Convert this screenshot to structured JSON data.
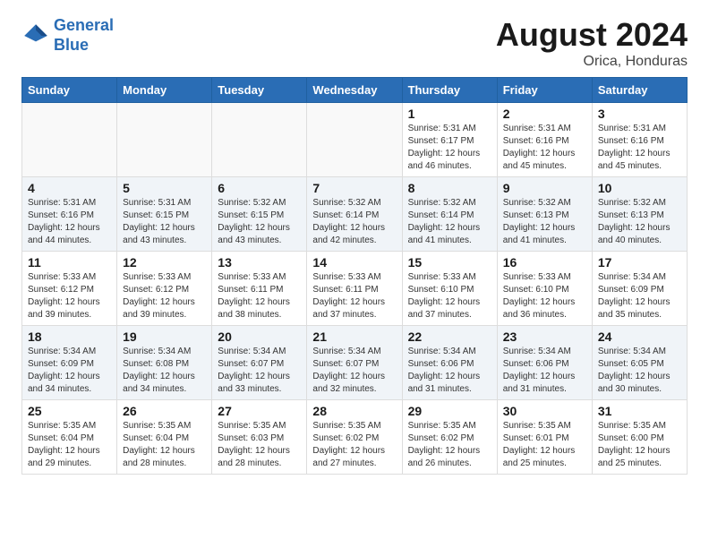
{
  "header": {
    "logo_line1": "General",
    "logo_line2": "Blue",
    "month_year": "August 2024",
    "location": "Orica, Honduras"
  },
  "days_of_week": [
    "Sunday",
    "Monday",
    "Tuesday",
    "Wednesday",
    "Thursday",
    "Friday",
    "Saturday"
  ],
  "weeks": [
    [
      {
        "day": "",
        "detail": ""
      },
      {
        "day": "",
        "detail": ""
      },
      {
        "day": "",
        "detail": ""
      },
      {
        "day": "",
        "detail": ""
      },
      {
        "day": "1",
        "detail": "Sunrise: 5:31 AM\nSunset: 6:17 PM\nDaylight: 12 hours\nand 46 minutes."
      },
      {
        "day": "2",
        "detail": "Sunrise: 5:31 AM\nSunset: 6:16 PM\nDaylight: 12 hours\nand 45 minutes."
      },
      {
        "day": "3",
        "detail": "Sunrise: 5:31 AM\nSunset: 6:16 PM\nDaylight: 12 hours\nand 45 minutes."
      }
    ],
    [
      {
        "day": "4",
        "detail": "Sunrise: 5:31 AM\nSunset: 6:16 PM\nDaylight: 12 hours\nand 44 minutes."
      },
      {
        "day": "5",
        "detail": "Sunrise: 5:31 AM\nSunset: 6:15 PM\nDaylight: 12 hours\nand 43 minutes."
      },
      {
        "day": "6",
        "detail": "Sunrise: 5:32 AM\nSunset: 6:15 PM\nDaylight: 12 hours\nand 43 minutes."
      },
      {
        "day": "7",
        "detail": "Sunrise: 5:32 AM\nSunset: 6:14 PM\nDaylight: 12 hours\nand 42 minutes."
      },
      {
        "day": "8",
        "detail": "Sunrise: 5:32 AM\nSunset: 6:14 PM\nDaylight: 12 hours\nand 41 minutes."
      },
      {
        "day": "9",
        "detail": "Sunrise: 5:32 AM\nSunset: 6:13 PM\nDaylight: 12 hours\nand 41 minutes."
      },
      {
        "day": "10",
        "detail": "Sunrise: 5:32 AM\nSunset: 6:13 PM\nDaylight: 12 hours\nand 40 minutes."
      }
    ],
    [
      {
        "day": "11",
        "detail": "Sunrise: 5:33 AM\nSunset: 6:12 PM\nDaylight: 12 hours\nand 39 minutes."
      },
      {
        "day": "12",
        "detail": "Sunrise: 5:33 AM\nSunset: 6:12 PM\nDaylight: 12 hours\nand 39 minutes."
      },
      {
        "day": "13",
        "detail": "Sunrise: 5:33 AM\nSunset: 6:11 PM\nDaylight: 12 hours\nand 38 minutes."
      },
      {
        "day": "14",
        "detail": "Sunrise: 5:33 AM\nSunset: 6:11 PM\nDaylight: 12 hours\nand 37 minutes."
      },
      {
        "day": "15",
        "detail": "Sunrise: 5:33 AM\nSunset: 6:10 PM\nDaylight: 12 hours\nand 37 minutes."
      },
      {
        "day": "16",
        "detail": "Sunrise: 5:33 AM\nSunset: 6:10 PM\nDaylight: 12 hours\nand 36 minutes."
      },
      {
        "day": "17",
        "detail": "Sunrise: 5:34 AM\nSunset: 6:09 PM\nDaylight: 12 hours\nand 35 minutes."
      }
    ],
    [
      {
        "day": "18",
        "detail": "Sunrise: 5:34 AM\nSunset: 6:09 PM\nDaylight: 12 hours\nand 34 minutes."
      },
      {
        "day": "19",
        "detail": "Sunrise: 5:34 AM\nSunset: 6:08 PM\nDaylight: 12 hours\nand 34 minutes."
      },
      {
        "day": "20",
        "detail": "Sunrise: 5:34 AM\nSunset: 6:07 PM\nDaylight: 12 hours\nand 33 minutes."
      },
      {
        "day": "21",
        "detail": "Sunrise: 5:34 AM\nSunset: 6:07 PM\nDaylight: 12 hours\nand 32 minutes."
      },
      {
        "day": "22",
        "detail": "Sunrise: 5:34 AM\nSunset: 6:06 PM\nDaylight: 12 hours\nand 31 minutes."
      },
      {
        "day": "23",
        "detail": "Sunrise: 5:34 AM\nSunset: 6:06 PM\nDaylight: 12 hours\nand 31 minutes."
      },
      {
        "day": "24",
        "detail": "Sunrise: 5:34 AM\nSunset: 6:05 PM\nDaylight: 12 hours\nand 30 minutes."
      }
    ],
    [
      {
        "day": "25",
        "detail": "Sunrise: 5:35 AM\nSunset: 6:04 PM\nDaylight: 12 hours\nand 29 minutes."
      },
      {
        "day": "26",
        "detail": "Sunrise: 5:35 AM\nSunset: 6:04 PM\nDaylight: 12 hours\nand 28 minutes."
      },
      {
        "day": "27",
        "detail": "Sunrise: 5:35 AM\nSunset: 6:03 PM\nDaylight: 12 hours\nand 28 minutes."
      },
      {
        "day": "28",
        "detail": "Sunrise: 5:35 AM\nSunset: 6:02 PM\nDaylight: 12 hours\nand 27 minutes."
      },
      {
        "day": "29",
        "detail": "Sunrise: 5:35 AM\nSunset: 6:02 PM\nDaylight: 12 hours\nand 26 minutes."
      },
      {
        "day": "30",
        "detail": "Sunrise: 5:35 AM\nSunset: 6:01 PM\nDaylight: 12 hours\nand 25 minutes."
      },
      {
        "day": "31",
        "detail": "Sunrise: 5:35 AM\nSunset: 6:00 PM\nDaylight: 12 hours\nand 25 minutes."
      }
    ]
  ]
}
